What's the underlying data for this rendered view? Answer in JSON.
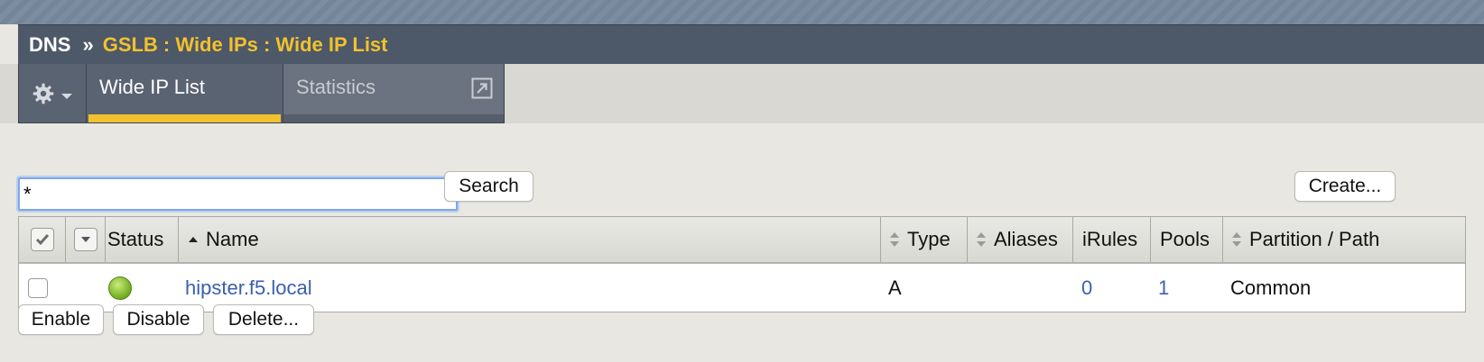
{
  "breadcrumb": {
    "root": "DNS",
    "separator": "»",
    "path": "GSLB : Wide IPs : Wide IP List"
  },
  "tabs": [
    {
      "label": "Wide IP List",
      "active": true
    },
    {
      "label": "Statistics",
      "active": false
    }
  ],
  "icons": {
    "gear": "gear-icon",
    "dropdown": "chevron-down-icon",
    "external": "external-link-icon",
    "sort_neutral": "sort-icon",
    "sort_asc": "sort-ascending-icon",
    "status": "status-green-circle-icon"
  },
  "search": {
    "value": "*",
    "button_label": "Search"
  },
  "create_button": "Create...",
  "table": {
    "columns": {
      "status": "Status",
      "name": "Name",
      "type": "Type",
      "aliases": "Aliases",
      "irules": "iRules",
      "pools": "Pools",
      "partition": "Partition / Path"
    },
    "rows": [
      {
        "status": "available",
        "name": "hipster.f5.local",
        "type": "A",
        "aliases": "",
        "irules": "0",
        "pools": "1",
        "partition": "Common"
      }
    ]
  },
  "actions": {
    "enable": "Enable",
    "disable": "Disable",
    "delete": "Delete..."
  },
  "colors": {
    "accent": "#f2c12e",
    "header_bg": "#4d5868",
    "link": "#3a5fb0",
    "status_green": "#7db52a"
  }
}
